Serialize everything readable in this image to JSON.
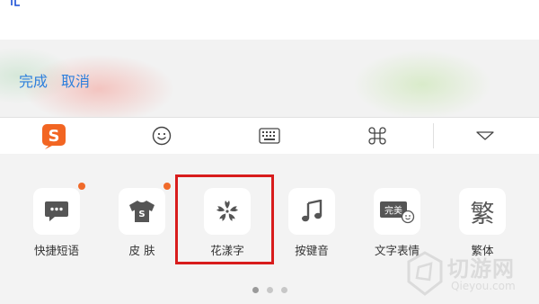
{
  "input": {
    "text": ""
  },
  "edit_bar": {
    "done_label": "完成",
    "cancel_label": "取消"
  },
  "toolbar": {
    "logo_letter": "S",
    "items": [
      "sogou-logo-icon",
      "emoji-icon",
      "keyboard-icon",
      "command-icon",
      "chevron-down-icon"
    ]
  },
  "apps": [
    {
      "label": "快捷短语",
      "icon": "chat-bubble-icon",
      "badge": true
    },
    {
      "label": "皮 肤",
      "icon": "tshirt-icon",
      "icon_text": "S",
      "badge": true
    },
    {
      "label": "花漾字",
      "icon": "flower-icon",
      "badge": false,
      "highlighted": true
    },
    {
      "label": "按键音",
      "icon": "music-note-icon",
      "badge": false
    },
    {
      "label": "文字表情",
      "icon": "text-emoji-icon",
      "icon_text": "完美",
      "badge": false
    },
    {
      "label": "繁体",
      "icon": "traditional-char-icon",
      "icon_text": "繁",
      "badge": false
    }
  ],
  "pager": {
    "pages": 3,
    "current": 1
  },
  "watermark": {
    "text_cn": "切游网",
    "text_en": "Qieyou.com"
  },
  "colors": {
    "accent": "#2d7fdc",
    "highlight": "#d81c1c",
    "badge": "#f06a2a",
    "logo": "#f26522"
  }
}
